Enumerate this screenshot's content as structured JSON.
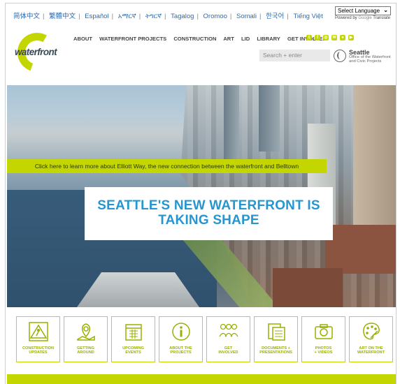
{
  "languages": [
    "简体中文",
    "繁體中文",
    "Español",
    "አማርኛ",
    "ትግርኛ",
    "Tagalog",
    "Oromoo",
    "Somali",
    "한국어",
    "Tiếng Việt"
  ],
  "translate": {
    "select_label": "Select Language",
    "powered_prefix": "Powered by",
    "google": "Google",
    "translate_word": "Translate"
  },
  "logo": {
    "wordmark": "waterfront"
  },
  "nav": [
    "ABOUT",
    "WATERFRONT PROJECTS",
    "CONSTRUCTION",
    "ART",
    "LID",
    "LIBRARY",
    "GET INVOLVED"
  ],
  "social_icons": [
    "twitter-icon",
    "facebook-icon",
    "instagram-icon",
    "email-icon",
    "flickr-icon",
    "youtube-icon"
  ],
  "search": {
    "placeholder": "Search + enter"
  },
  "seattle_logo": {
    "title": "Seattle",
    "subtitle_line1": "Office of the Waterfront",
    "subtitle_line2": "and Civic Projects"
  },
  "hero": {
    "banner": "Click here to learn more about Elliott Way, the new connection between the waterfront and Belltown",
    "headline_line1": "SEATTLE'S NEW WATERFRONT IS",
    "headline_line2": "TAKING SHAPE"
  },
  "tiles": [
    {
      "icon": "construction-sign-icon",
      "line1": "CONSTRUCTION",
      "line2": "UPDATES"
    },
    {
      "icon": "map-pin-icon",
      "line1": "GETTING",
      "line2": "AROUND"
    },
    {
      "icon": "calendar-icon",
      "line1": "UPCOMING",
      "line2": "EVENTS"
    },
    {
      "icon": "info-icon",
      "line1": "ABOUT THE",
      "line2": "PROJECTS"
    },
    {
      "icon": "people-icon",
      "line1": "GET",
      "line2": "INVOLVED"
    },
    {
      "icon": "documents-icon",
      "line1": "DOCUMENTS +",
      "line2": "PRESENTATIONS"
    },
    {
      "icon": "camera-icon",
      "line1": "PHOTOS",
      "line2": "+ VIDEOS"
    },
    {
      "icon": "paint-palette-icon",
      "line1": "ART ON THE",
      "line2": "WATERFRONT"
    }
  ],
  "colors": {
    "accent": "#c4d600",
    "headline": "#2596cf",
    "link": "#2b6cb0"
  }
}
